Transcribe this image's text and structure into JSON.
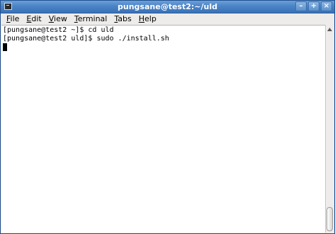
{
  "window": {
    "title": "pungsane@test2:~/uld",
    "controls": {
      "minimize": "–",
      "maximize": "+",
      "close": "×"
    },
    "icon": "terminal-icon"
  },
  "menubar": {
    "items": [
      {
        "mnemonic": "F",
        "rest": "ile"
      },
      {
        "mnemonic": "E",
        "rest": "dit"
      },
      {
        "mnemonic": "V",
        "rest": "iew"
      },
      {
        "mnemonic": "T",
        "rest": "erminal"
      },
      {
        "mnemonic": "T",
        "rest": "abs"
      },
      {
        "mnemonic": "H",
        "rest": "elp"
      }
    ]
  },
  "terminal": {
    "lines": [
      "[pungsane@test2 ~]$ cd uld",
      "[pungsane@test2 uld]$ sudo ./install.sh"
    ]
  },
  "colors": {
    "titlebar": "#4a83c6",
    "terminal_bg": "#ffffff",
    "terminal_fg": "#000000",
    "chrome": "#edeceb"
  }
}
